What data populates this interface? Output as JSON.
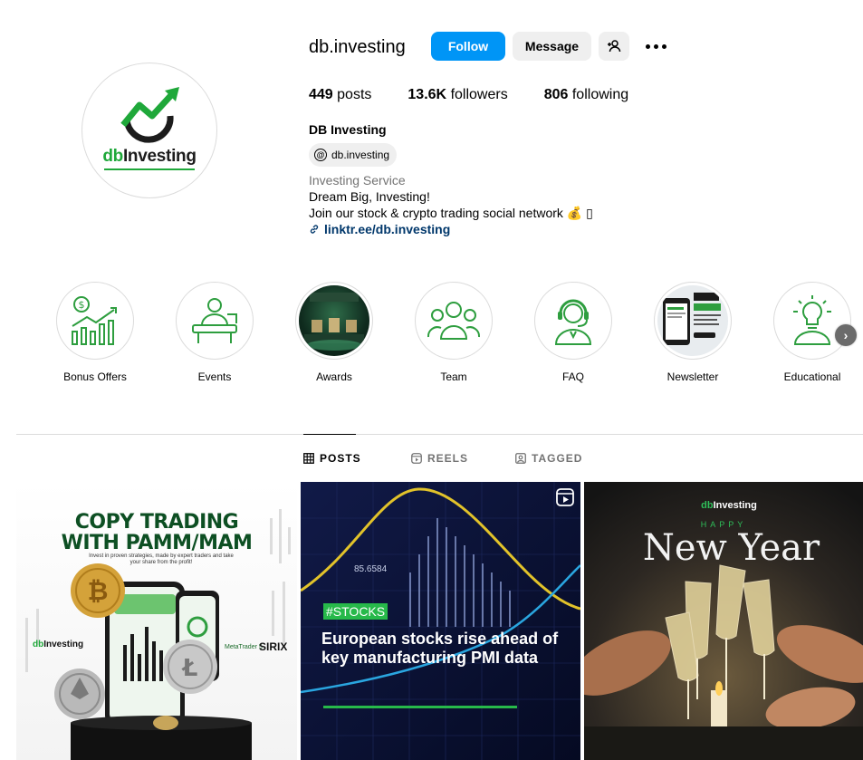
{
  "profile": {
    "username": "db.investing",
    "avatar_logo": {
      "db": "db",
      "investing": "Investing"
    },
    "buttons": {
      "follow": "Follow",
      "message": "Message"
    },
    "stats": {
      "posts_count": "449",
      "posts_label": "posts",
      "followers_count": "13.6K",
      "followers_label": "followers",
      "following_count": "806",
      "following_label": "following"
    },
    "full_name": "DB Investing",
    "threads_handle": "db.investing",
    "category": "Investing Service",
    "bio_line1": "Dream Big, Investing!",
    "bio_line2": "Join our stock & crypto trading social network 💰 ▯",
    "link": "linktr.ee/db.investing"
  },
  "highlights": [
    {
      "label": "Bonus Offers",
      "icon": "bonus-chart-icon"
    },
    {
      "label": "Events",
      "icon": "presenter-icon"
    },
    {
      "label": "Awards",
      "icon": "awards-image"
    },
    {
      "label": "Team",
      "icon": "team-icon"
    },
    {
      "label": "FAQ",
      "icon": "support-agent-icon"
    },
    {
      "label": "Newsletter",
      "icon": "newsletter-image"
    },
    {
      "label": "Educational",
      "icon": "lightbulb-person-icon"
    }
  ],
  "tabs": [
    {
      "label": "POSTS",
      "icon": "grid-icon",
      "active": true
    },
    {
      "label": "REELS",
      "icon": "reels-icon",
      "active": false
    },
    {
      "label": "TAGGED",
      "icon": "tagged-icon",
      "active": false
    }
  ],
  "posts": [
    {
      "title_line1": "COPY TRADING",
      "title_line2": "WITH PAMM/MAM",
      "subtitle": "Invest in proven strategies, made by expert traders and take your share from the profit!"
    },
    {
      "tag": "#STOCKS",
      "title": "European stocks rise ahead of key manufacturing PMI data",
      "price": "85.6584"
    },
    {
      "brand_db": "db",
      "brand_rest": "Investing",
      "happy": "HAPPY",
      "new_year": "New Year"
    }
  ],
  "colors": {
    "accent": "#0095f6",
    "brand_green": "#1fa83a",
    "link": "#00376b",
    "muted": "#737373",
    "button_gray": "#efefef"
  }
}
